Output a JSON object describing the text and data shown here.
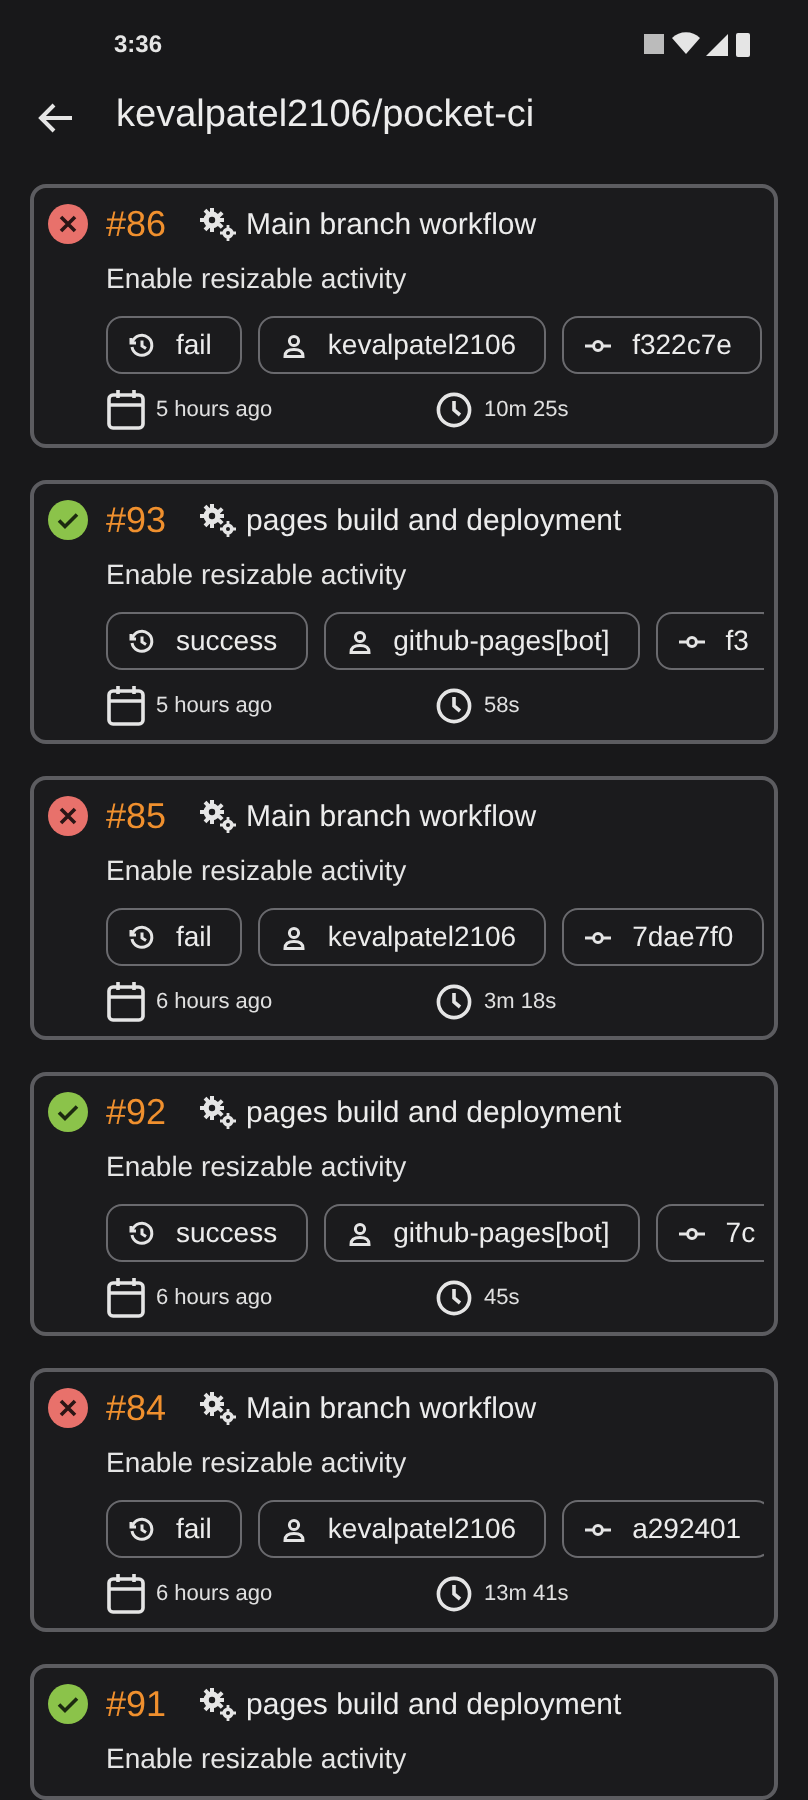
{
  "status_bar": {
    "time": "3:36"
  },
  "header": {
    "title": "kevalpatel2106/pocket-ci"
  },
  "runs": [
    {
      "succeeded": false,
      "number": "#86",
      "workflow": "Main branch workflow",
      "message": "Enable resizable activity",
      "chips": [
        {
          "kind": "status",
          "text": "fail"
        },
        {
          "kind": "user",
          "text": "kevalpatel2106"
        },
        {
          "kind": "commit",
          "text": "f322c7e"
        }
      ],
      "time_ago": "5 hours ago",
      "duration": "10m 25s"
    },
    {
      "succeeded": true,
      "number": "#93",
      "workflow": "pages build and deployment",
      "message": "Enable resizable activity",
      "chips": [
        {
          "kind": "status",
          "text": "success"
        },
        {
          "kind": "user",
          "text": "github-pages[bot]"
        },
        {
          "kind": "commit",
          "text": "f3"
        }
      ],
      "time_ago": "5 hours ago",
      "duration": "58s"
    },
    {
      "succeeded": false,
      "number": "#85",
      "workflow": "Main branch workflow",
      "message": "Enable resizable activity",
      "chips": [
        {
          "kind": "status",
          "text": "fail"
        },
        {
          "kind": "user",
          "text": "kevalpatel2106"
        },
        {
          "kind": "commit",
          "text": "7dae7f0"
        }
      ],
      "time_ago": "6 hours ago",
      "duration": "3m 18s"
    },
    {
      "succeeded": true,
      "number": "#92",
      "workflow": "pages build and deployment",
      "message": "Enable resizable activity",
      "chips": [
        {
          "kind": "status",
          "text": "success"
        },
        {
          "kind": "user",
          "text": "github-pages[bot]"
        },
        {
          "kind": "commit",
          "text": "7c"
        }
      ],
      "time_ago": "6 hours ago",
      "duration": "45s"
    },
    {
      "succeeded": false,
      "number": "#84",
      "workflow": "Main branch workflow",
      "message": "Enable resizable activity",
      "chips": [
        {
          "kind": "status",
          "text": "fail"
        },
        {
          "kind": "user",
          "text": "kevalpatel2106"
        },
        {
          "kind": "commit",
          "text": "a292401"
        }
      ],
      "time_ago": "6 hours ago",
      "duration": "13m 41s"
    },
    {
      "succeeded": true,
      "number": "#91",
      "workflow": "pages build and deployment",
      "message": "Enable resizable activity"
    }
  ]
}
